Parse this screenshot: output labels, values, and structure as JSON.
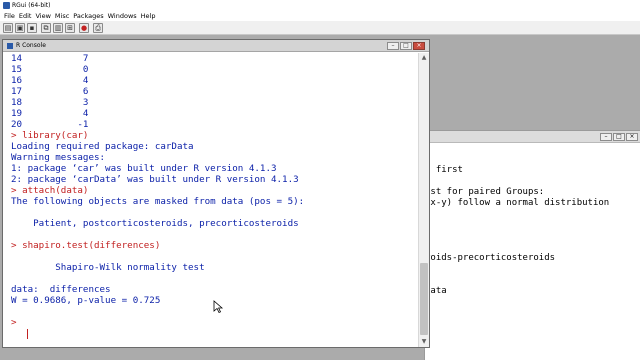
{
  "app": {
    "title": "RGui (64-bit)",
    "icon": "r-app-icon"
  },
  "menu": [
    "File",
    "Edit",
    "View",
    "Misc",
    "Packages",
    "Windows",
    "Help"
  ],
  "toolbar": {
    "buttons": [
      {
        "icon": "open-script-icon",
        "glyph": "▤"
      },
      {
        "icon": "load-workspace-icon",
        "glyph": "▣"
      },
      {
        "icon": "save-workspace-icon",
        "glyph": "▪"
      },
      {
        "icon": "copy-icon",
        "glyph": "⧉"
      },
      {
        "icon": "paste-icon",
        "glyph": "▥"
      },
      {
        "icon": "copy-paste-icon",
        "glyph": "⊞"
      },
      {
        "icon": "stop-icon",
        "glyph": "●"
      },
      {
        "icon": "print-icon",
        "glyph": "⎙"
      }
    ]
  },
  "console": {
    "title": "R Console",
    "lines": [
      {
        "text": "14           7",
        "style": "out"
      },
      {
        "text": "15           0",
        "style": "out"
      },
      {
        "text": "16           4",
        "style": "out"
      },
      {
        "text": "17           6",
        "style": "out"
      },
      {
        "text": "18           3",
        "style": "out"
      },
      {
        "text": "19           4",
        "style": "out"
      },
      {
        "text": "20          -1",
        "style": "out"
      },
      {
        "text": "> library(car)",
        "style": "cmd"
      },
      {
        "text": "Loading required package: carData",
        "style": "out"
      },
      {
        "text": "Warning messages:",
        "style": "out"
      },
      {
        "text": "1: package ‘car’ was built under R version 4.1.3",
        "style": "out"
      },
      {
        "text": "2: package ‘carData’ was built under R version 4.1.3",
        "style": "out"
      },
      {
        "text": "> attach(data)",
        "style": "cmd"
      },
      {
        "text": "The following objects are masked from data (pos = 5):",
        "style": "out"
      },
      {
        "text": "",
        "style": "out"
      },
      {
        "text": "    Patient, postcorticosteroids, precorticosteroids",
        "style": "out"
      },
      {
        "text": "",
        "style": "out"
      },
      {
        "text": "> shapiro.test(differences)",
        "style": "cmd"
      },
      {
        "text": "",
        "style": "out"
      },
      {
        "text": "        Shapiro-Wilk normality test",
        "style": "out"
      },
      {
        "text": "",
        "style": "out"
      },
      {
        "text": "data:  differences",
        "style": "out"
      },
      {
        "text": "W = 0.9686, p-value = 0.725",
        "style": "out"
      },
      {
        "text": "",
        "style": "out"
      },
      {
        "text": "> ",
        "style": "cmd"
      }
    ]
  },
  "background_window": {
    "lines": [
      "s first",
      "",
      "est for paired Groups:",
      " x-y) follow a normal distribution",
      "",
      "",
      "",
      "roids-precorticosteroids",
      "",
      "",
      "",
      "data"
    ]
  },
  "colors": {
    "command": "#c22121",
    "output": "#0a1fa8",
    "mdi_background": "#ababab"
  }
}
